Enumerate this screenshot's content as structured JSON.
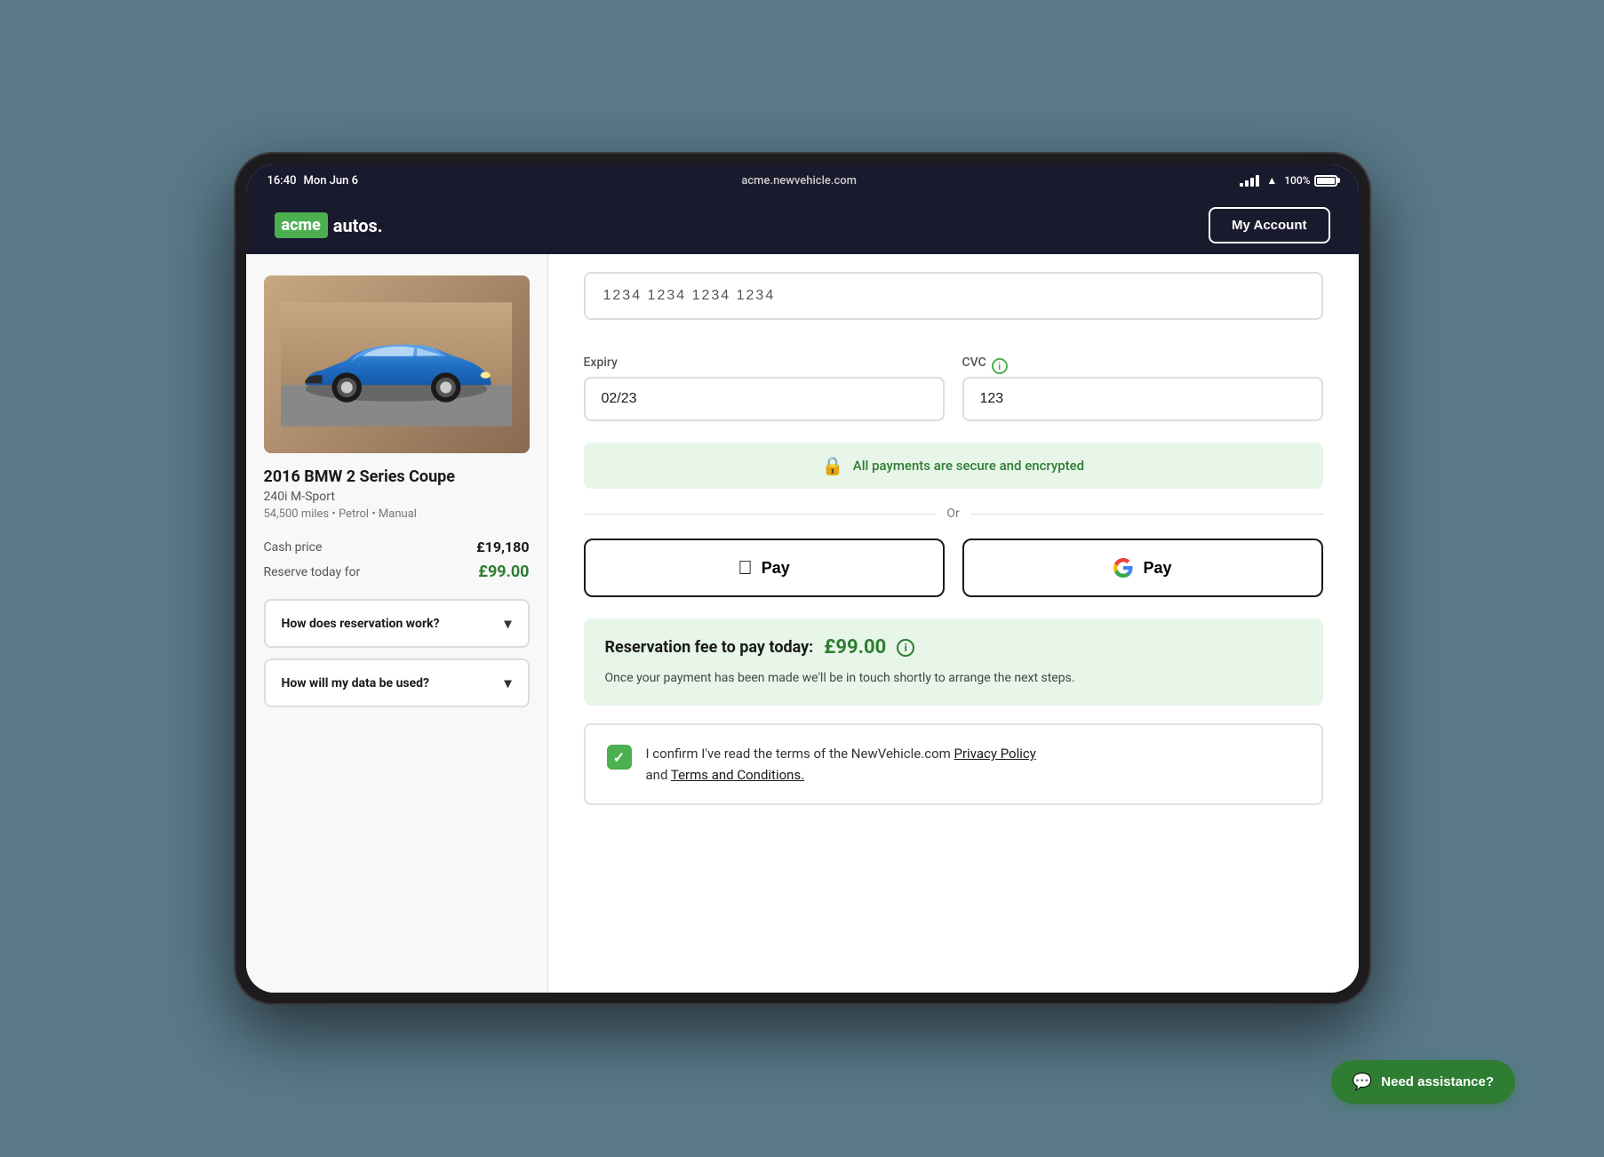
{
  "status_bar": {
    "time": "16:40",
    "date": "Mon Jun 6",
    "url": "acme.newvehicle.com",
    "signal": "●●●●",
    "wifi": "wifi",
    "battery": "100%"
  },
  "nav": {
    "logo_acme": "acme",
    "logo_autos": "autos.",
    "my_account": "My Account"
  },
  "car": {
    "title": "2016 BMW 2 Series Coupe",
    "subtitle": "240i M-Sport",
    "specs": "54,500 miles  •  Petrol  •  Manual",
    "cash_price_label": "Cash price",
    "cash_price_value": "£19,180",
    "reserve_label": "Reserve today for",
    "reserve_value": "£99.00"
  },
  "accordions": [
    {
      "label": "How does reservation work?"
    },
    {
      "label": "How will my data be used?"
    }
  ],
  "payment_form": {
    "card_number": "1234 1234 1234 1234",
    "expiry_label": "Expiry",
    "expiry_value": "02/23",
    "cvc_label": "CVC",
    "cvc_value": "123",
    "secure_text": "All payments are secure and encrypted",
    "or_text": "Or",
    "apple_pay_label": "Pay",
    "google_pay_label": "Pay"
  },
  "reservation": {
    "title": "Reservation fee to pay today:",
    "amount": "£99.00",
    "description": "Once your payment has been made we'll be in touch shortly to arrange the next steps."
  },
  "terms": {
    "text_before": "I confirm I've read the terms of the NewVehicle.com",
    "privacy_policy": "Privacy Policy",
    "text_between": "and",
    "terms_conditions": "Terms and Conditions."
  },
  "assistance": {
    "label": "Need assistance?"
  }
}
